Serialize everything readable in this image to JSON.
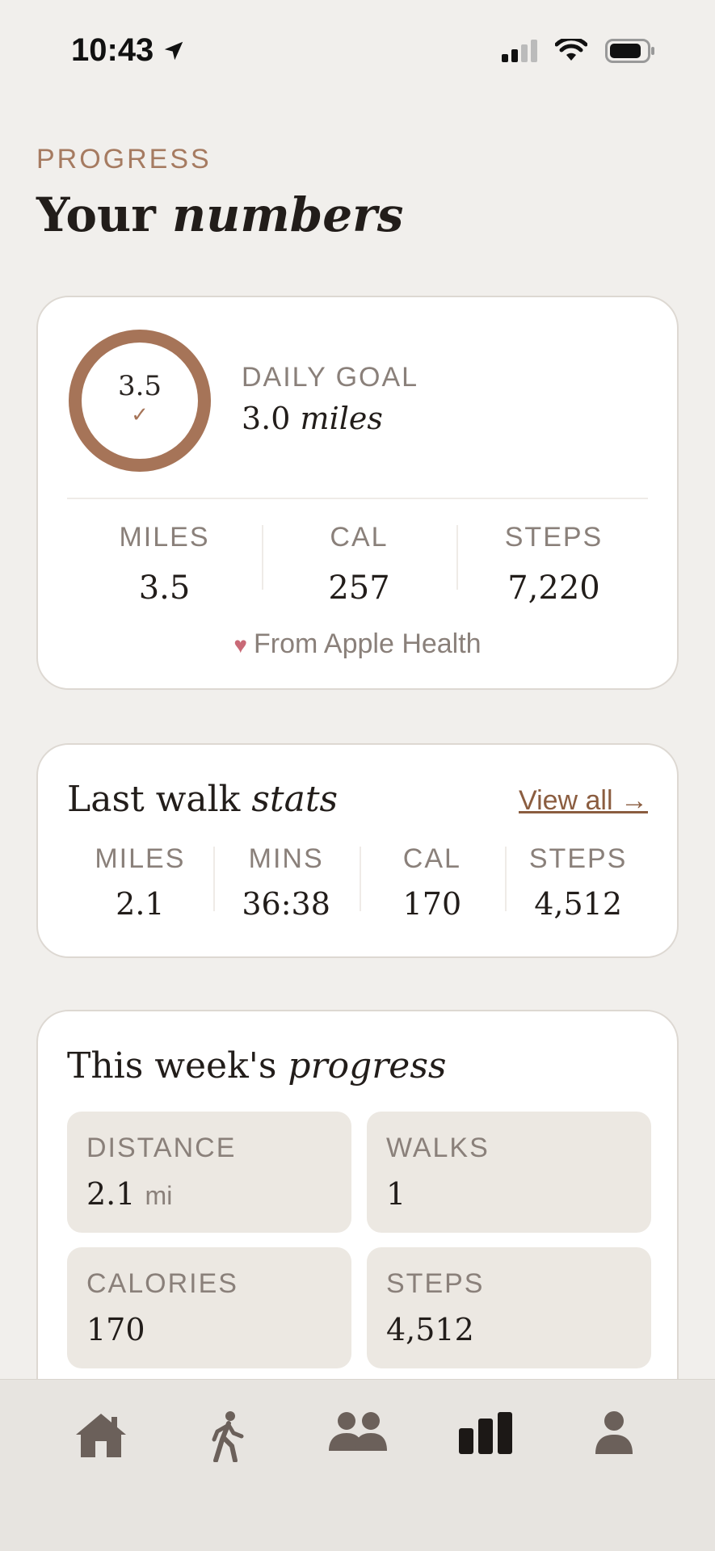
{
  "status_bar": {
    "time": "10:43",
    "icons": [
      "location-arrow-icon",
      "cellular-signal-icon",
      "wifi-icon",
      "battery-icon"
    ]
  },
  "header": {
    "eyebrow": "PROGRESS",
    "title_regular": "Your",
    "title_italic": "numbers"
  },
  "daily_goal": {
    "ring_value": "3.5",
    "ring_check": "✓",
    "progress_fraction": 1.0,
    "label": "DAILY GOAL",
    "goal_number": "3.0",
    "goal_unit": "miles",
    "stats": [
      {
        "label": "MILES",
        "value": "3.5"
      },
      {
        "label": "CAL",
        "value": "257"
      },
      {
        "label": "STEPS",
        "value": "7,220"
      }
    ],
    "source_note": "From Apple Health"
  },
  "last_walk": {
    "title_regular": "Last walk",
    "title_italic": "stats",
    "view_all": "View all →",
    "stats": [
      {
        "label": "MILES",
        "value": "2.1"
      },
      {
        "label": "MINS",
        "value": "36:38"
      },
      {
        "label": "CAL",
        "value": "170"
      },
      {
        "label": "STEPS",
        "value": "4,512"
      }
    ]
  },
  "week": {
    "title_regular": "This week's",
    "title_italic": "progress",
    "tiles": [
      {
        "label": "DISTANCE",
        "value": "2.1",
        "unit": "mi"
      },
      {
        "label": "WALKS",
        "value": "1",
        "unit": ""
      },
      {
        "label": "CALORIES",
        "value": "170",
        "unit": ""
      },
      {
        "label": "STEPS",
        "value": "4,512",
        "unit": ""
      }
    ]
  },
  "tab_bar": {
    "tabs": [
      {
        "icon": "home-icon",
        "active": false
      },
      {
        "icon": "walking-icon",
        "active": false
      },
      {
        "icon": "people-icon",
        "active": false
      },
      {
        "icon": "bar-chart-icon",
        "active": true
      },
      {
        "icon": "person-icon",
        "active": false
      }
    ]
  },
  "colors": {
    "background": "#f1efec",
    "accent": "#a67458",
    "card": "#ffffff",
    "tile": "#ece8e2",
    "heart": "#c96a77"
  }
}
